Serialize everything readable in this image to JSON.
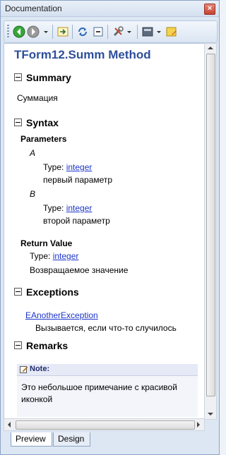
{
  "window": {
    "title": "Documentation",
    "close_glyph": "×"
  },
  "toolbar": {
    "icons": [
      "back-icon",
      "forward-icon",
      "dropdown-icon",
      "sync-icon",
      "refresh-icon",
      "collapse-icon",
      "tools-icon",
      "view-icon",
      "note-icon"
    ]
  },
  "doc": {
    "title": "TForm12.Summ Method",
    "summary": {
      "heading": "Summary",
      "text": "Суммация"
    },
    "syntax": {
      "heading": "Syntax",
      "parameters_label": "Parameters",
      "params": [
        {
          "name": "A",
          "type_label": "Type:",
          "type": "integer",
          "desc": "первый параметр"
        },
        {
          "name": "B",
          "type_label": "Type:",
          "type": "integer",
          "desc": "второй параметр"
        }
      ],
      "return_label": "Return Value",
      "return_type_label": "Type:",
      "return_type": "integer",
      "return_desc": "Возвращаемое значение"
    },
    "exceptions": {
      "heading": "Exceptions",
      "name": "EAnotherException",
      "desc": "Вызывается, если что-то случилось"
    },
    "remarks": {
      "heading": "Remarks",
      "note_label": "Note:",
      "note_text": "Это небольшое примечание с красивой иконкой"
    }
  },
  "tabs": [
    {
      "label": "Preview",
      "active": true
    },
    {
      "label": "Design",
      "active": false
    }
  ],
  "colors": {
    "heading": "#2e4f9a",
    "link": "#1d35c9",
    "note_bg": "#f4f5fb"
  }
}
